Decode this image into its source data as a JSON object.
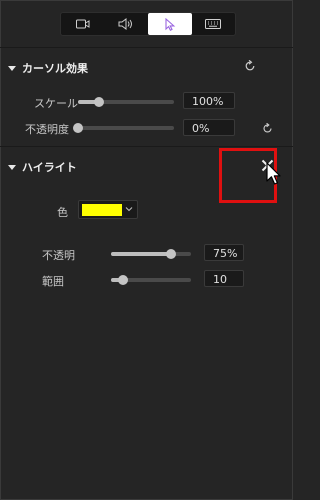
{
  "tabs": [
    {
      "icon": "video-camera-icon",
      "active": false
    },
    {
      "icon": "speaker-icon",
      "active": false
    },
    {
      "icon": "cursor-pointer-icon",
      "active": true
    },
    {
      "icon": "keyboard-icon",
      "active": false
    }
  ],
  "cursor_effects": {
    "title": "カーソル効果",
    "scale": {
      "label": "スケール",
      "value": "100%",
      "level": 0.22
    },
    "opacity": {
      "label": "不透明度",
      "value": "0%",
      "level": 0.0
    }
  },
  "highlight": {
    "title": "ハイライト",
    "color": {
      "label": "色",
      "value": "#ffff00"
    },
    "opacity": {
      "label": "不透明",
      "value": "75%",
      "level": 0.75
    },
    "range": {
      "label": "範囲",
      "value": "10",
      "level": 0.15
    }
  },
  "colors": {
    "accent_box": "#e01010",
    "swatch": "#ffff00",
    "active_tab": "#ffffff"
  }
}
